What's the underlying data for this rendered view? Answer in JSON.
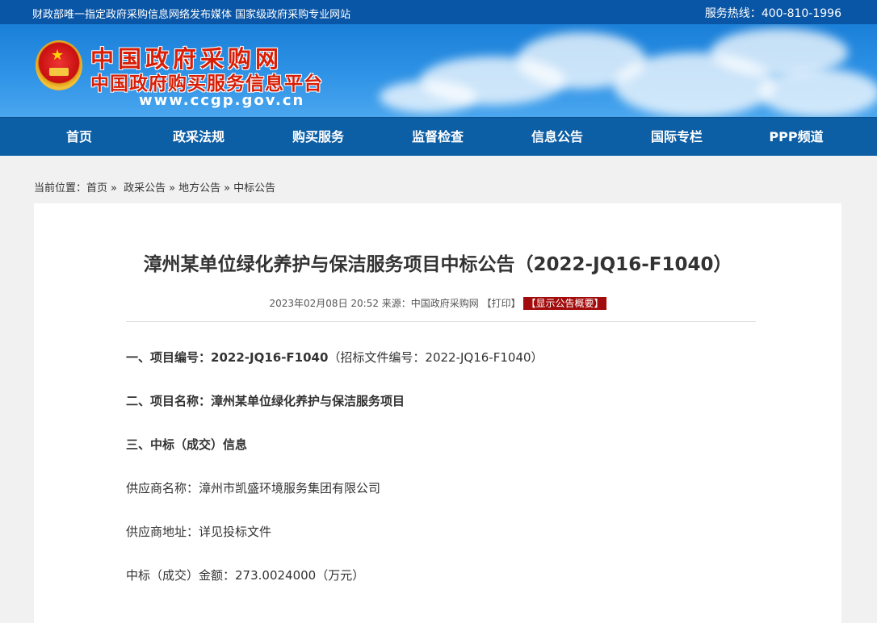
{
  "topbar": {
    "slogan": "财政部唯一指定政府采购信息网络发布媒体 国家级政府采购专业网站",
    "hotline_label": "服务热线：",
    "hotline_number": "400-810-1996"
  },
  "brand": {
    "title": "中国政府采购网",
    "subtitle": "中国政府购买服务信息平台",
    "url": "www.ccgp.gov.cn"
  },
  "nav": {
    "items": [
      "首页",
      "政采法规",
      "购买服务",
      "监督检查",
      "信息公告",
      "国际专栏",
      "PPP频道"
    ]
  },
  "breadcrumb": {
    "label": "当前位置：",
    "items": [
      "首页",
      "政采公告",
      "地方公告",
      "中标公告"
    ],
    "sep": "»"
  },
  "article": {
    "title": "漳州某单位绿化养护与保洁服务项目中标公告（2022-JQ16-F1040）",
    "meta_date": "2023年02月08日 20:52",
    "meta_source": "来源：中国政府采购网",
    "meta_print": "【打印】",
    "meta_summary": "【显示公告概要】",
    "sec1_label": "一、项目编号：",
    "sec1_value": "2022-JQ16-F1040",
    "sec1_extra": "（招标文件编号：2022-JQ16-F1040）",
    "sec2_label": "二、项目名称：",
    "sec2_value": "漳州某单位绿化养护与保洁服务项目",
    "sec3_heading": "三、中标（成交）信息",
    "supplier_name": "供应商名称：漳州市凯盛环境服务集团有限公司",
    "supplier_addr": "供应商地址：详见投标文件",
    "amount": "中标（成交）金额：273.0024000（万元）"
  },
  "colors": {
    "topbar": "#0a56a6",
    "nav": "#0c5ea5",
    "brand_red": "#d81e06",
    "badge": "#a30c0c"
  }
}
